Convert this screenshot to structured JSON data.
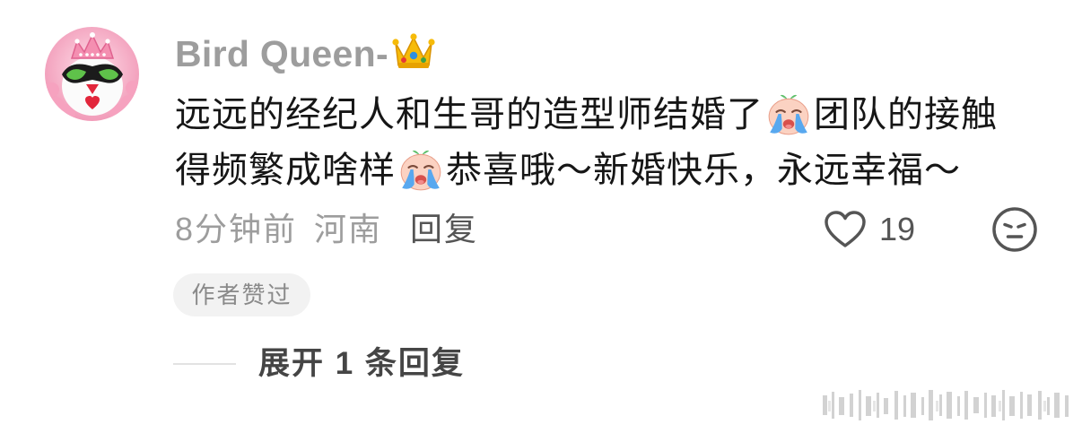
{
  "comment": {
    "avatar_icon": "avatar-penguin-tiara",
    "username": "Bird Queen-",
    "username_emoji": "crown-emoji",
    "content": [
      {
        "text": "远远的经纪人和生哥的造型师结婚了"
      },
      {
        "emoji": "crying-face-emoji"
      },
      {
        "text": "团队的接触"
      },
      {
        "text": "得频繁成啥样"
      },
      {
        "emoji": "crying-face-emoji"
      },
      {
        "text": "恭喜哦～新婚快乐，永远幸福～"
      }
    ],
    "time_ago": "8分钟前",
    "location": "河南",
    "reply_label": "回复",
    "like_icon": "heart-outline-icon",
    "like_count": "19",
    "dislike_icon": "neutral-face-icon",
    "author_liked_badge": "作者赞过",
    "expand_replies_label": "展开 1 条回复"
  },
  "colors": {
    "text_primary": "#161616",
    "text_secondary": "#9d9d9d",
    "text_action": "#555555",
    "badge_bg": "#f2f2f2",
    "badge_text": "#8a8a8a",
    "divider": "#e2e2e2",
    "expand_text": "#454545"
  }
}
